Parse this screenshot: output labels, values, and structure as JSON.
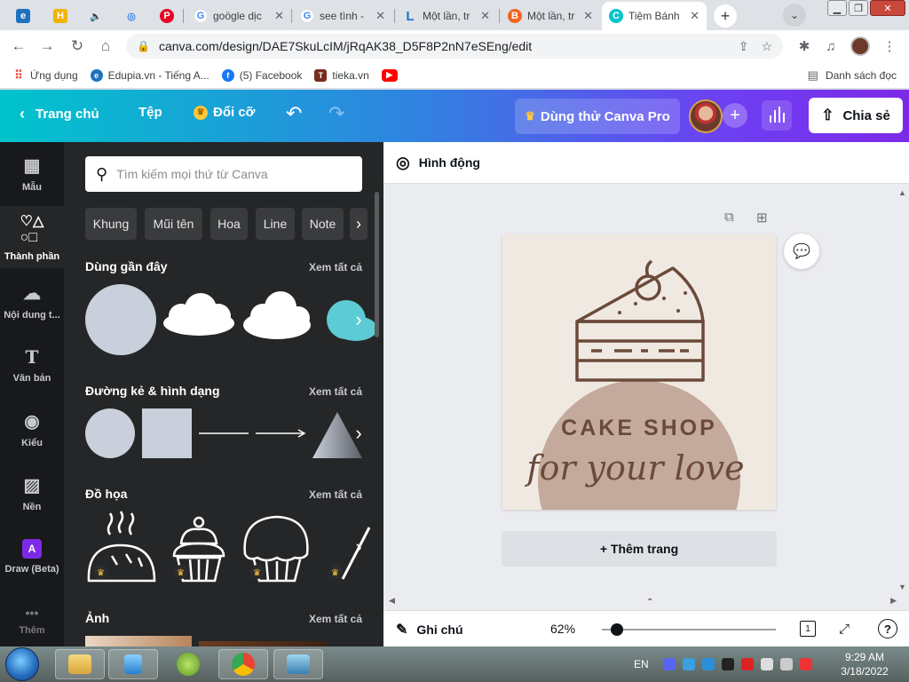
{
  "browser": {
    "tabs": [
      {
        "title": "",
        "favicon_color": "#1e73be",
        "favicon": "e"
      },
      {
        "title": "",
        "favicon_color": "#f0b400",
        "favicon": "H"
      },
      {
        "title": "",
        "favicon_color": "#5f6368",
        "favicon": "🔈"
      },
      {
        "title": "",
        "favicon_color": "#3b82f6",
        "favicon": "◎"
      },
      {
        "title": "",
        "favicon_color": "#e60023",
        "favicon": "P"
      },
      {
        "title": "goögle dịc",
        "favicon_color": "#4285f4",
        "favicon": "G"
      },
      {
        "title": "see tình -",
        "favicon_color": "#4285f4",
        "favicon": "G"
      },
      {
        "title": "Một lần, tr",
        "favicon_color": "#1976d2",
        "favicon": "L"
      },
      {
        "title": "Một lần, tr",
        "favicon_color": "#f26522",
        "favicon": "B"
      },
      {
        "title": "Tiệm Bánh",
        "favicon_color": "#00c4cc",
        "favicon": "C"
      }
    ],
    "new_tab": "+",
    "url": "canva.com/design/DAE7SkuLcIM/jRqAK38_D5F8P2nN7eSEng/edit",
    "bookmarks": [
      {
        "label": "Ứng dụng",
        "color": "#ea4335"
      },
      {
        "label": "Edupia.vn - Tiếng A...",
        "color": "#1e73be"
      },
      {
        "label": "(5) Facebook",
        "color": "#1877f2"
      },
      {
        "label": "tieka.vn",
        "color": "#7a2b1e"
      },
      {
        "label": "",
        "color": "#ff0000"
      }
    ],
    "reading_list": "Danh sách đọc"
  },
  "canva": {
    "home": "Trang chủ",
    "file": "Tệp",
    "resize": "Đổi cỡ",
    "try_pro": "Dùng thử Canva Pro",
    "share": "Chia sẻ",
    "rail": [
      {
        "label": "Mẫu",
        "icon": "▦"
      },
      {
        "label": "Thành phần",
        "icon": "♡△"
      },
      {
        "label": "Nội dung t...",
        "icon": "☁"
      },
      {
        "label": "Văn bản",
        "icon": "T"
      },
      {
        "label": "Kiểu",
        "icon": "◉"
      },
      {
        "label": "Nền",
        "icon": "▨"
      },
      {
        "label": "Draw (Beta)",
        "icon": "A"
      },
      {
        "label": "Thêm",
        "icon": "•••"
      }
    ],
    "search_placeholder": "Tìm kiếm mọi thứ từ Canva",
    "chips": [
      "Khung",
      "Mũi tên",
      "Hoa",
      "Line",
      "Note"
    ],
    "sections": {
      "recent": "Dùng gần đây",
      "lines_shapes": "Đường kẻ & hình dạng",
      "graphics": "Đồ họa",
      "photos": "Ảnh",
      "see_all": "Xem tất cả"
    },
    "animate": "Hình động",
    "design": {
      "title": "CAKE SHOP",
      "tagline": "for your love",
      "bg_color": "#f0e9e2",
      "circle_color": "#c4aa9c",
      "ink_color": "#6b4a3a"
    },
    "add_page": "+ Thêm trang",
    "notes": "Ghi chú",
    "zoom": "62%",
    "page_count": "1",
    "help": "?"
  },
  "taskbar": {
    "lang": "EN",
    "time": "9:29 AM",
    "date": "3/18/2022"
  }
}
